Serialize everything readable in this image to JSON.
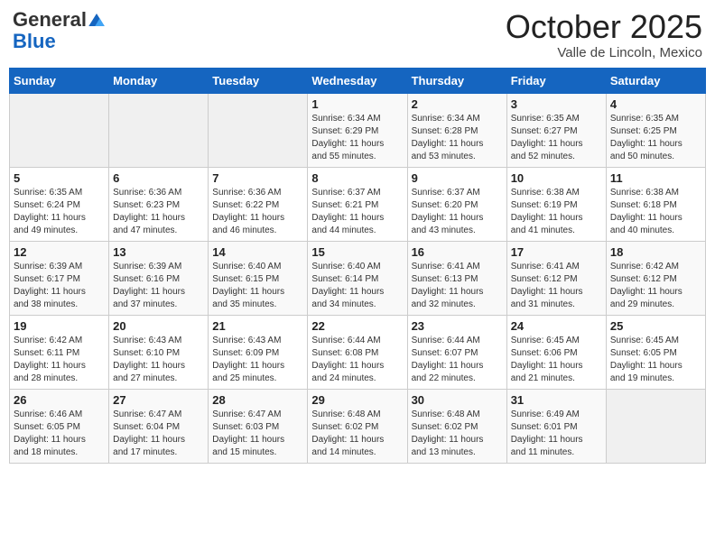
{
  "header": {
    "logo_general": "General",
    "logo_blue": "Blue",
    "month": "October 2025",
    "location": "Valle de Lincoln, Mexico"
  },
  "days_of_week": [
    "Sunday",
    "Monday",
    "Tuesday",
    "Wednesday",
    "Thursday",
    "Friday",
    "Saturday"
  ],
  "weeks": [
    [
      {
        "day": "",
        "info": ""
      },
      {
        "day": "",
        "info": ""
      },
      {
        "day": "",
        "info": ""
      },
      {
        "day": "1",
        "info": "Sunrise: 6:34 AM\nSunset: 6:29 PM\nDaylight: 11 hours\nand 55 minutes."
      },
      {
        "day": "2",
        "info": "Sunrise: 6:34 AM\nSunset: 6:28 PM\nDaylight: 11 hours\nand 53 minutes."
      },
      {
        "day": "3",
        "info": "Sunrise: 6:35 AM\nSunset: 6:27 PM\nDaylight: 11 hours\nand 52 minutes."
      },
      {
        "day": "4",
        "info": "Sunrise: 6:35 AM\nSunset: 6:25 PM\nDaylight: 11 hours\nand 50 minutes."
      }
    ],
    [
      {
        "day": "5",
        "info": "Sunrise: 6:35 AM\nSunset: 6:24 PM\nDaylight: 11 hours\nand 49 minutes."
      },
      {
        "day": "6",
        "info": "Sunrise: 6:36 AM\nSunset: 6:23 PM\nDaylight: 11 hours\nand 47 minutes."
      },
      {
        "day": "7",
        "info": "Sunrise: 6:36 AM\nSunset: 6:22 PM\nDaylight: 11 hours\nand 46 minutes."
      },
      {
        "day": "8",
        "info": "Sunrise: 6:37 AM\nSunset: 6:21 PM\nDaylight: 11 hours\nand 44 minutes."
      },
      {
        "day": "9",
        "info": "Sunrise: 6:37 AM\nSunset: 6:20 PM\nDaylight: 11 hours\nand 43 minutes."
      },
      {
        "day": "10",
        "info": "Sunrise: 6:38 AM\nSunset: 6:19 PM\nDaylight: 11 hours\nand 41 minutes."
      },
      {
        "day": "11",
        "info": "Sunrise: 6:38 AM\nSunset: 6:18 PM\nDaylight: 11 hours\nand 40 minutes."
      }
    ],
    [
      {
        "day": "12",
        "info": "Sunrise: 6:39 AM\nSunset: 6:17 PM\nDaylight: 11 hours\nand 38 minutes."
      },
      {
        "day": "13",
        "info": "Sunrise: 6:39 AM\nSunset: 6:16 PM\nDaylight: 11 hours\nand 37 minutes."
      },
      {
        "day": "14",
        "info": "Sunrise: 6:40 AM\nSunset: 6:15 PM\nDaylight: 11 hours\nand 35 minutes."
      },
      {
        "day": "15",
        "info": "Sunrise: 6:40 AM\nSunset: 6:14 PM\nDaylight: 11 hours\nand 34 minutes."
      },
      {
        "day": "16",
        "info": "Sunrise: 6:41 AM\nSunset: 6:13 PM\nDaylight: 11 hours\nand 32 minutes."
      },
      {
        "day": "17",
        "info": "Sunrise: 6:41 AM\nSunset: 6:12 PM\nDaylight: 11 hours\nand 31 minutes."
      },
      {
        "day": "18",
        "info": "Sunrise: 6:42 AM\nSunset: 6:12 PM\nDaylight: 11 hours\nand 29 minutes."
      }
    ],
    [
      {
        "day": "19",
        "info": "Sunrise: 6:42 AM\nSunset: 6:11 PM\nDaylight: 11 hours\nand 28 minutes."
      },
      {
        "day": "20",
        "info": "Sunrise: 6:43 AM\nSunset: 6:10 PM\nDaylight: 11 hours\nand 27 minutes."
      },
      {
        "day": "21",
        "info": "Sunrise: 6:43 AM\nSunset: 6:09 PM\nDaylight: 11 hours\nand 25 minutes."
      },
      {
        "day": "22",
        "info": "Sunrise: 6:44 AM\nSunset: 6:08 PM\nDaylight: 11 hours\nand 24 minutes."
      },
      {
        "day": "23",
        "info": "Sunrise: 6:44 AM\nSunset: 6:07 PM\nDaylight: 11 hours\nand 22 minutes."
      },
      {
        "day": "24",
        "info": "Sunrise: 6:45 AM\nSunset: 6:06 PM\nDaylight: 11 hours\nand 21 minutes."
      },
      {
        "day": "25",
        "info": "Sunrise: 6:45 AM\nSunset: 6:05 PM\nDaylight: 11 hours\nand 19 minutes."
      }
    ],
    [
      {
        "day": "26",
        "info": "Sunrise: 6:46 AM\nSunset: 6:05 PM\nDaylight: 11 hours\nand 18 minutes."
      },
      {
        "day": "27",
        "info": "Sunrise: 6:47 AM\nSunset: 6:04 PM\nDaylight: 11 hours\nand 17 minutes."
      },
      {
        "day": "28",
        "info": "Sunrise: 6:47 AM\nSunset: 6:03 PM\nDaylight: 11 hours\nand 15 minutes."
      },
      {
        "day": "29",
        "info": "Sunrise: 6:48 AM\nSunset: 6:02 PM\nDaylight: 11 hours\nand 14 minutes."
      },
      {
        "day": "30",
        "info": "Sunrise: 6:48 AM\nSunset: 6:02 PM\nDaylight: 11 hours\nand 13 minutes."
      },
      {
        "day": "31",
        "info": "Sunrise: 6:49 AM\nSunset: 6:01 PM\nDaylight: 11 hours\nand 11 minutes."
      },
      {
        "day": "",
        "info": ""
      }
    ]
  ]
}
